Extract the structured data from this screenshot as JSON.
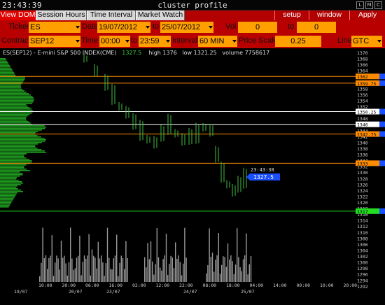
{
  "window": {
    "clock": "23:43:39",
    "title": "cluster profile",
    "buttons": [
      "L",
      "M",
      "C"
    ]
  },
  "tabs": [
    {
      "label": "View DOM",
      "active": true
    },
    {
      "label": "Session Hours",
      "active": false
    },
    {
      "label": "Time Interval",
      "active": false
    },
    {
      "label": "Market Watch",
      "active": false
    }
  ],
  "menu": {
    "setup": "setup",
    "window": "window",
    "apply": "Apply"
  },
  "controls": {
    "ticker_label": "Ticker",
    "ticker": "ES",
    "date_label": "Date",
    "date_from": "19/07/2012",
    "date_to_label": "to",
    "date_to": "25/07/2012",
    "vol_range_label": "Vol range",
    "vol_from": "0",
    "vol_to_label": "to",
    "vol_to": "0",
    "contract_label": "Contract",
    "contract": "SEP12",
    "time_label": "Time",
    "time_from": "00:00",
    "time_to_label": "to",
    "time_to": "23:59",
    "interval_label": "Interval",
    "interval": "60 MIN",
    "price_scale_label": "Price Scale",
    "price_scale": "0.25",
    "line_label": "Line",
    "line": "GTC"
  },
  "chart": {
    "symbol": "ES(SEP12) - E-mini S&P 500 INDEX(CME)",
    "last_price": "1327.5",
    "high_label": "high",
    "high": "1376",
    "low_label": "low",
    "low": "1321.25",
    "volume_label": "volume",
    "volume": "7758617",
    "current_time_label": "23:43:38",
    "current_price_label": "1327.5",
    "price_axis": [
      "1370",
      "1368",
      "1366",
      "1364",
      "1362",
      "1360",
      "1358",
      "1356",
      "1354",
      "1352",
      "1350",
      "1348",
      "1346",
      "1344",
      "1342",
      "1340",
      "1338",
      "1336",
      "1334",
      "1332",
      "1330",
      "1328",
      "1326",
      "1324",
      "1322",
      "1320",
      "1318",
      "1316",
      "1314",
      "1312",
      "1310",
      "1308",
      "1306",
      "1304",
      "1302",
      "1300",
      "1298",
      "1296",
      "1294",
      "1292"
    ],
    "level_lines": [
      {
        "price": 1362,
        "label": "1362",
        "color": "#ff8c00"
      },
      {
        "price": 1359.75,
        "label": "1359.75",
        "color": "#ff8c00"
      },
      {
        "price": 1350.25,
        "label": "1350.25",
        "color": "#ffffff"
      },
      {
        "price": 1346,
        "label": "1346",
        "color": "#ffffff"
      },
      {
        "price": 1342.75,
        "label": "1342.75",
        "color": "#ff8c00"
      },
      {
        "price": 1333,
        "label": "1333",
        "color": "#ff8c00"
      },
      {
        "price": 1317,
        "label": "1317",
        "color": "#22dd22"
      }
    ],
    "time_axis": [
      "10:00",
      "20:00",
      "06:00",
      "16:00",
      "02:00",
      "12:00",
      "22:00",
      "08:00",
      "18:00",
      "04:00",
      "14:00",
      "00:00",
      "10:00",
      "20:00",
      "06:00",
      "16:00",
      "02:00",
      "12:00",
      "22:00",
      "08:00",
      "18:00",
      "04:00",
      "14:00"
    ],
    "date_axis": [
      "19/07",
      "20/07",
      "23/07",
      "24/07",
      "25/07"
    ]
  },
  "colors": {
    "accent": "#b80000",
    "field": "#ffa000",
    "profile": "#1f9a1f",
    "candle": "#3fbf3f",
    "volume": "#9a9a9a",
    "orange_line": "#ff8c00",
    "current_price": "#1a4fff"
  }
}
